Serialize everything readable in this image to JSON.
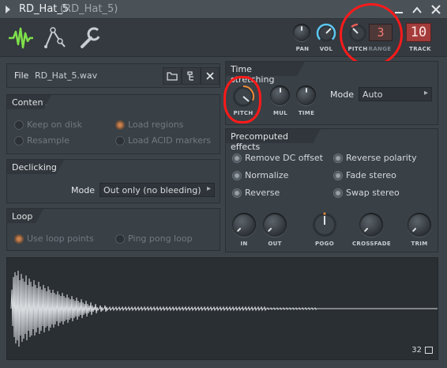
{
  "window": {
    "title": "RD_Hat_5",
    "subtitle": "(RD_Hat_5)",
    "menu_icon": "triangle-right-icon",
    "buttons": [
      "minimize-icon",
      "restore-icon",
      "close-icon"
    ]
  },
  "toolbar": {
    "tabs": [
      "waveform-tab-icon",
      "envelope-tab-icon",
      "wrench-tab-icon"
    ],
    "knobs": {
      "pan": "PAN",
      "vol": "VOL",
      "pitch": "PITCH",
      "range_label": "RANGE"
    },
    "range_value": "3",
    "track_value": "10",
    "track_label": "TRACK"
  },
  "file_panel": {
    "label": "File",
    "filename": "RD_Hat_5.wav"
  },
  "content": {
    "heading": "Content",
    "options": [
      {
        "label": "Keep on disk",
        "state": "off"
      },
      {
        "label": "Load regions",
        "state": "on"
      },
      {
        "label": "Resample",
        "state": "off"
      },
      {
        "label": "Load ACID markers",
        "state": "off"
      }
    ]
  },
  "declicking": {
    "heading": "Declicking",
    "mode_label": "Mode",
    "mode_value": "Out only (no bleeding)"
  },
  "loop": {
    "heading": "Loop",
    "options": [
      {
        "label": "Use loop points",
        "state": "on"
      },
      {
        "label": "Ping pong loop",
        "state": "off"
      }
    ]
  },
  "time_stretching": {
    "heading": "Time stretching",
    "knobs": [
      "PITCH",
      "MUL",
      "TIME"
    ],
    "mode_label": "Mode",
    "mode_value": "Auto"
  },
  "precomputed": {
    "heading": "Precomputed effects",
    "options": [
      "Remove DC offset",
      "Reverse polarity",
      "Normalize",
      "Fade stereo",
      "Reverse",
      "Swap stereo"
    ],
    "knobs": [
      "IN",
      "OUT",
      "POGO",
      "CROSSFADE",
      "TRIM"
    ]
  },
  "waveform": {
    "resolution": "32"
  },
  "colors": {
    "accent_green": "#7fe04a",
    "accent_orange": "#e98c3a",
    "accent_blue": "#5cc6f0",
    "annotation_red": "#ff1a1a",
    "track_red": "#e45b55"
  }
}
